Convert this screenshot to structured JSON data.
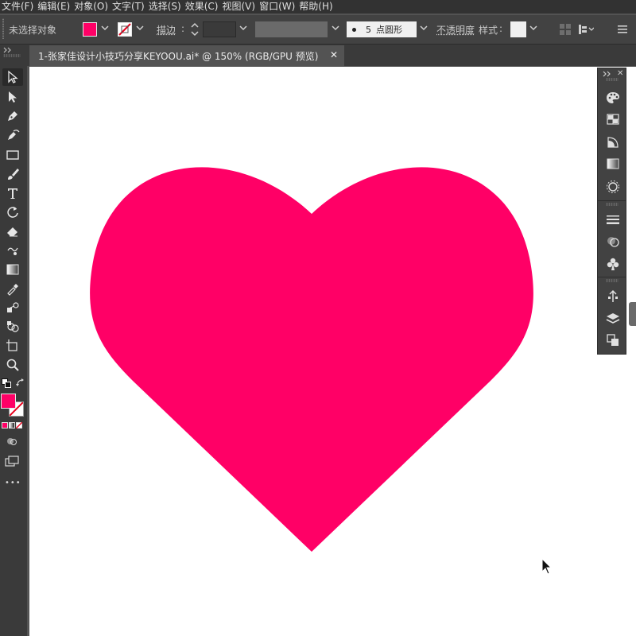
{
  "menubar": {
    "items": [
      "文件(F)",
      "编辑(E)",
      "对象(O)",
      "文字(T)",
      "选择(S)",
      "效果(C)",
      "视图(V)",
      "窗口(W)",
      "帮助(H)"
    ]
  },
  "controlbar": {
    "selection_status": "未选择对象",
    "stroke_label": "描边",
    "stroke_sep": ":",
    "brush_size": "5",
    "brush_name": "点圆形",
    "opacity_label": "不透明度",
    "style_label": "样式",
    "style_sep": ":"
  },
  "document": {
    "tab_title": "1-张家佳设计小技巧分享KEYOOU.ai* @ 150% (RGB/GPU 预览)",
    "close_glyph": "✕"
  },
  "colors": {
    "fill": "#ff0066",
    "canvas": "#ffffff",
    "app_bg": "#535353"
  },
  "toolbar": {
    "tools": [
      "selection-tool",
      "direct-selection-tool",
      "pen-tool",
      "curvature-tool",
      "rectangle-tool",
      "paintbrush-tool",
      "type-tool",
      "rotate-tool",
      "eraser-tool",
      "warp-tool",
      "gradient-tool",
      "eyedropper-tool",
      "blend-tool",
      "shape-builder-tool",
      "artboard-tool",
      "zoom-tool"
    ],
    "more_glyph": "•••"
  },
  "right_panel": {
    "icons": [
      "color-panel",
      "swatches-panel",
      "color-guide-panel",
      "gradient-panel",
      "appearance-panel",
      "stroke-panel",
      "transparency-panel",
      "symbols-panel",
      "libraries-panel",
      "layers-panel",
      "artboards-panel"
    ]
  },
  "artwork": {
    "shape": "heart",
    "fill_color": "#ff0066"
  }
}
